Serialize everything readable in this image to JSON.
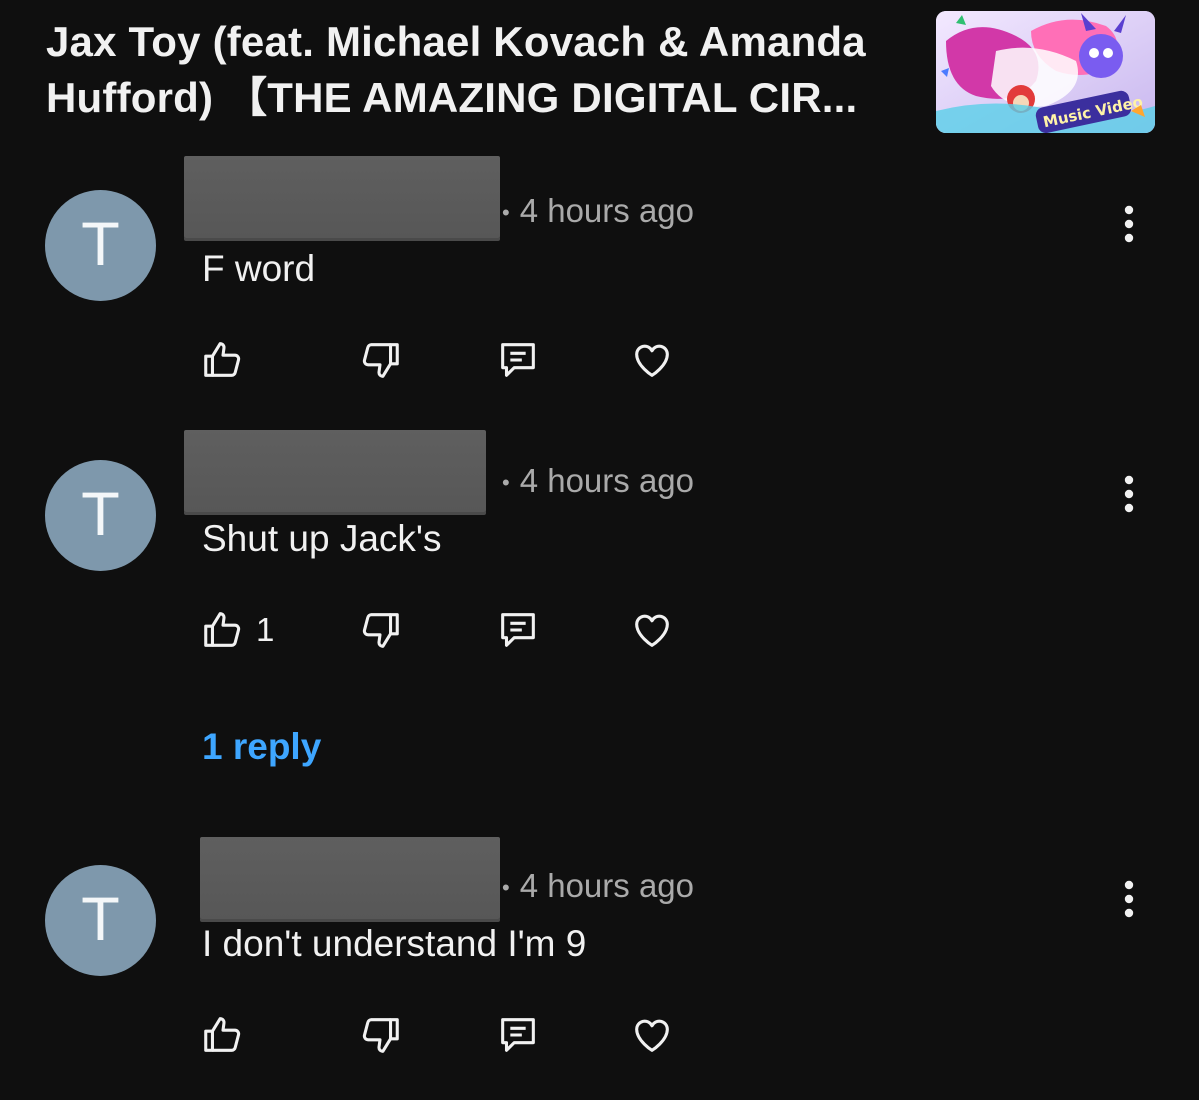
{
  "video": {
    "title": "Jax Toy (feat. Michael Kovach & Amanda\nHufford) 【THE AMAZING DIGITAL CIR...",
    "thumbnail_icon": "music-video-thumbnail"
  },
  "comments": [
    {
      "avatar_letter": "T",
      "author_redacted": true,
      "time": "4 hours ago",
      "text": "F word",
      "likes": ""
    },
    {
      "avatar_letter": "T",
      "author_redacted": true,
      "time": "4 hours ago",
      "text": "Shut up Jack's",
      "likes": "1"
    },
    {
      "avatar_letter": "T",
      "author_redacted": true,
      "time": "4 hours ago",
      "text": "I don't understand I'm 9",
      "likes": ""
    }
  ],
  "replies": {
    "label": "1 reply"
  },
  "icons": {
    "like": "thumbs-up-icon",
    "dislike": "thumbs-down-icon",
    "reply": "comment-icon",
    "heart": "heart-icon",
    "more": "more-vertical-icon"
  },
  "colors": {
    "background": "#0f0f0f",
    "avatar": "#7e98ac",
    "link": "#3ea6ff",
    "meta": "#aaaaaa"
  }
}
